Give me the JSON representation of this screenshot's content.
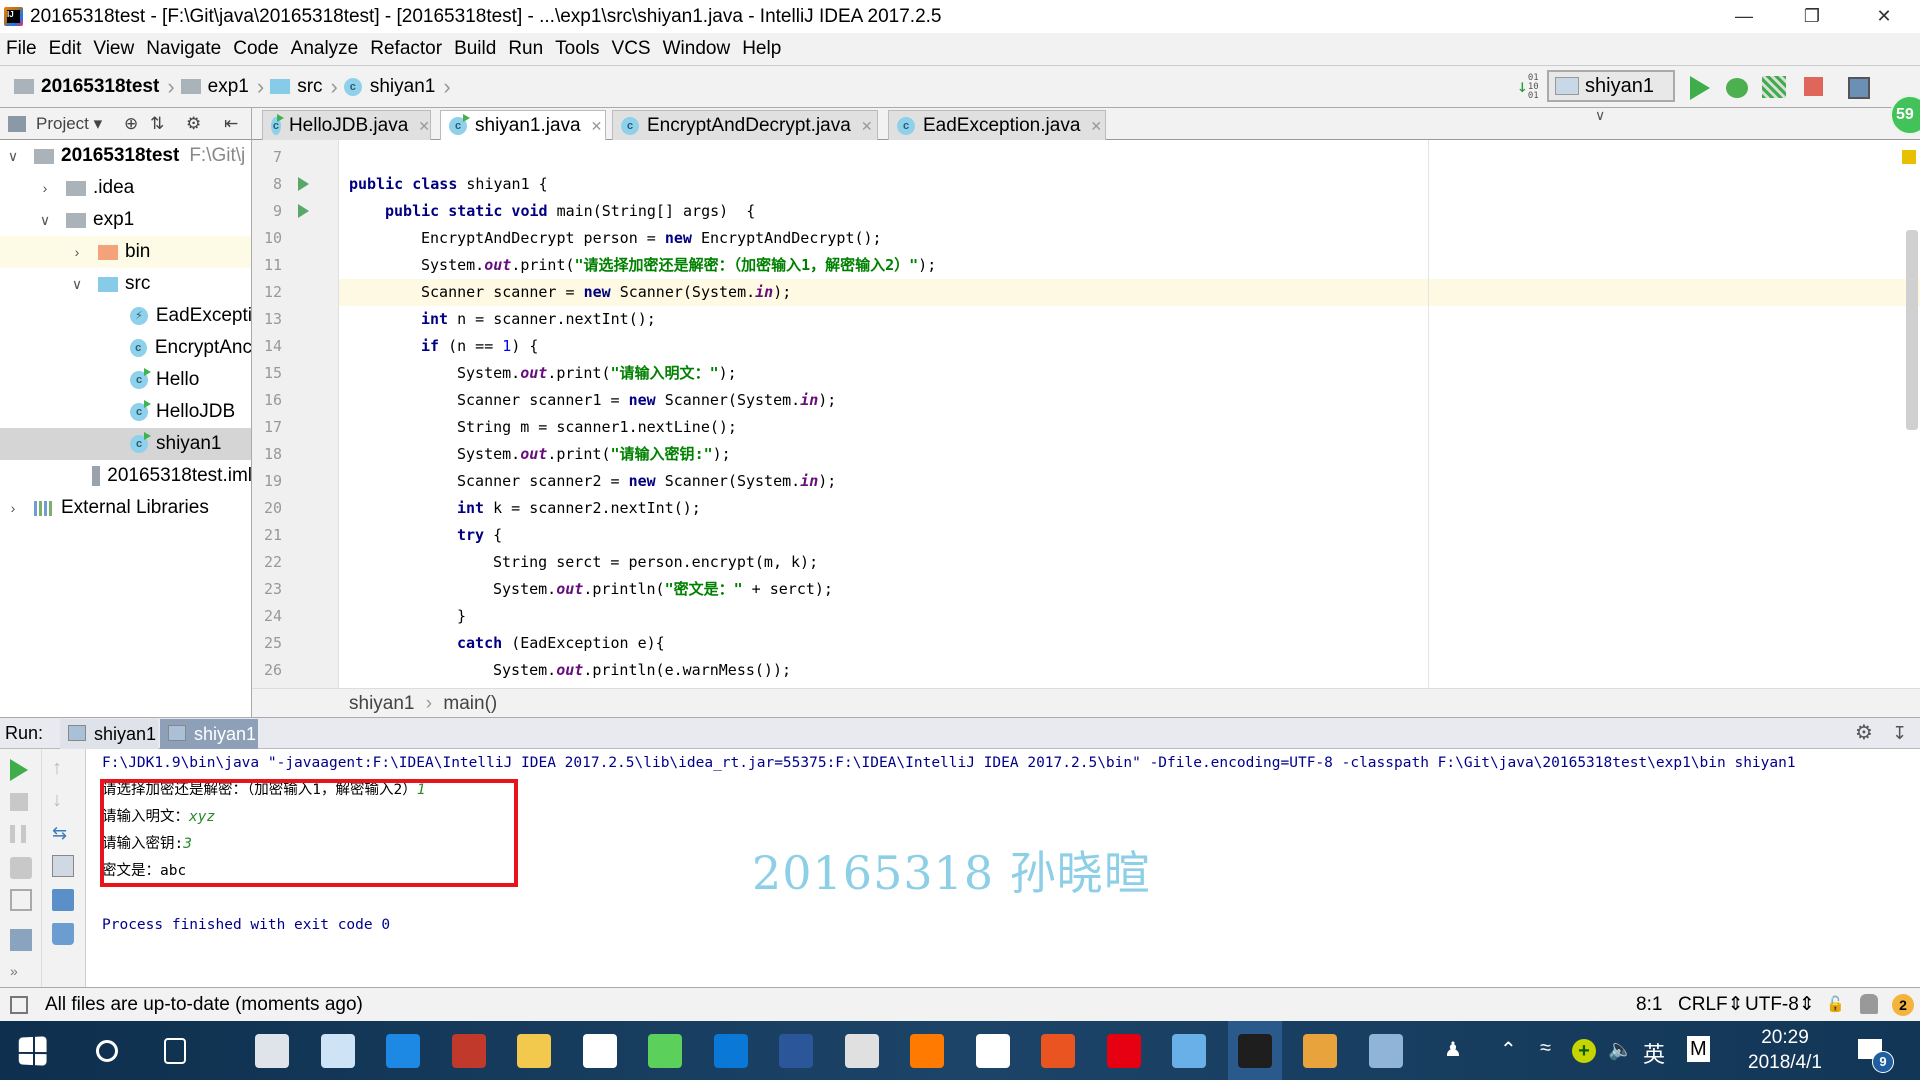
{
  "window": {
    "title": "20165318test - [F:\\Git\\java\\20165318test] - [20165318test] - ...\\exp1\\src\\shiyan1.java - IntelliJ IDEA 2017.2.5",
    "app_icon_text": "IJ"
  },
  "menu": [
    "File",
    "Edit",
    "View",
    "Navigate",
    "Code",
    "Analyze",
    "Refactor",
    "Build",
    "Run",
    "Tools",
    "VCS",
    "Window",
    "Help"
  ],
  "navbar": {
    "crumbs": [
      "20165318test",
      "exp1",
      "src",
      "shiyan1"
    ],
    "run_config": "shiyan1",
    "badge": "59"
  },
  "project": {
    "header": "Project",
    "items": [
      {
        "label": "20165318test",
        "extra": "F:\\Git\\j",
        "depth": 0,
        "arrow": "down",
        "icon": "module"
      },
      {
        "label": ".idea",
        "depth": 1,
        "arrow": "right",
        "icon": "folder"
      },
      {
        "label": "exp1",
        "depth": 1,
        "arrow": "down",
        "icon": "folder"
      },
      {
        "label": "bin",
        "depth": 2,
        "arrow": "right",
        "icon": "folder-orange"
      },
      {
        "label": "src",
        "depth": 2,
        "arrow": "down",
        "icon": "folder-blue"
      },
      {
        "label": "EadExcepti",
        "depth": 3,
        "icon": "exception"
      },
      {
        "label": "EncryptAnc",
        "depth": 3,
        "icon": "class"
      },
      {
        "label": "Hello",
        "depth": 3,
        "icon": "class-run"
      },
      {
        "label": "HelloJDB",
        "depth": 3,
        "icon": "class-run"
      },
      {
        "label": "shiyan1",
        "depth": 3,
        "icon": "class-run",
        "selected": true
      },
      {
        "label": "20165318test.iml",
        "depth": 2,
        "icon": "iml"
      },
      {
        "label": "External Libraries",
        "depth": 0,
        "arrow": "right",
        "icon": "libraries"
      }
    ]
  },
  "tabs": [
    {
      "label": "HelloJDB.java"
    },
    {
      "label": "shiyan1.java",
      "active": true
    },
    {
      "label": "EncryptAndDecrypt.java"
    },
    {
      "label": "EadException.java"
    }
  ],
  "editor": {
    "current_line": 12,
    "lines": [
      {
        "n": "7",
        "indent": 0,
        "tokens": []
      },
      {
        "n": "8",
        "indent": 0,
        "run": true,
        "tokens": [
          [
            "public class ",
            "kw"
          ],
          [
            "shiyan1 {",
            ""
          ]
        ]
      },
      {
        "n": "9",
        "indent": 1,
        "run": true,
        "tokens": [
          [
            "public static void ",
            "kw"
          ],
          [
            "main(String[] args)  {",
            ""
          ]
        ]
      },
      {
        "n": "10",
        "indent": 2,
        "tokens": [
          [
            "EncryptAndDecrypt person = ",
            ""
          ],
          [
            "new ",
            "kw"
          ],
          [
            "EncryptAndDecrypt();",
            ""
          ]
        ]
      },
      {
        "n": "11",
        "indent": 2,
        "tokens": [
          [
            "System.",
            ""
          ],
          [
            "out",
            "fld"
          ],
          [
            ".print(",
            ""
          ],
          [
            "\"请选择加密还是解密：（加密输入1，解密输入2）\"",
            "str"
          ],
          [
            ");",
            ""
          ]
        ]
      },
      {
        "n": "12",
        "indent": 2,
        "tokens": [
          [
            "Scanner scanner = ",
            ""
          ],
          [
            "new ",
            "kw"
          ],
          [
            "Scanner(System.",
            ""
          ],
          [
            "in",
            "fld"
          ],
          [
            ");",
            ""
          ]
        ]
      },
      {
        "n": "13",
        "indent": 2,
        "tokens": [
          [
            "int ",
            "kw"
          ],
          [
            "n = scanner.nextInt();",
            ""
          ]
        ]
      },
      {
        "n": "14",
        "indent": 2,
        "tokens": [
          [
            "if ",
            "kw"
          ],
          [
            "(n == ",
            ""
          ],
          [
            "1",
            "num"
          ],
          [
            ") {",
            ""
          ]
        ]
      },
      {
        "n": "15",
        "indent": 3,
        "tokens": [
          [
            "System.",
            ""
          ],
          [
            "out",
            "fld"
          ],
          [
            ".print(",
            ""
          ],
          [
            "\"请输入明文：\"",
            "str"
          ],
          [
            ");",
            ""
          ]
        ]
      },
      {
        "n": "16",
        "indent": 3,
        "tokens": [
          [
            "Scanner scanner1 = ",
            ""
          ],
          [
            "new ",
            "kw"
          ],
          [
            "Scanner(System.",
            ""
          ],
          [
            "in",
            "fld"
          ],
          [
            ");",
            ""
          ]
        ]
      },
      {
        "n": "17",
        "indent": 3,
        "tokens": [
          [
            "String m = scanner1.nextLine();",
            ""
          ]
        ]
      },
      {
        "n": "18",
        "indent": 3,
        "tokens": [
          [
            "System.",
            ""
          ],
          [
            "out",
            "fld"
          ],
          [
            ".print(",
            ""
          ],
          [
            "\"请输入密钥:\"",
            "str"
          ],
          [
            ");",
            ""
          ]
        ]
      },
      {
        "n": "19",
        "indent": 3,
        "tokens": [
          [
            "Scanner scanner2 = ",
            ""
          ],
          [
            "new ",
            "kw"
          ],
          [
            "Scanner(System.",
            ""
          ],
          [
            "in",
            "fld"
          ],
          [
            ");",
            ""
          ]
        ]
      },
      {
        "n": "20",
        "indent": 3,
        "tokens": [
          [
            "int ",
            "kw"
          ],
          [
            "k = scanner2.nextInt();",
            ""
          ]
        ]
      },
      {
        "n": "21",
        "indent": 3,
        "tokens": [
          [
            "try ",
            "kw"
          ],
          [
            "{",
            ""
          ]
        ]
      },
      {
        "n": "22",
        "indent": 4,
        "tokens": [
          [
            "String serct = person.encrypt(m, k);",
            ""
          ]
        ]
      },
      {
        "n": "23",
        "indent": 4,
        "tokens": [
          [
            "System.",
            ""
          ],
          [
            "out",
            "fld"
          ],
          [
            ".println(",
            ""
          ],
          [
            "\"密文是：\"",
            "str"
          ],
          [
            " + serct);",
            ""
          ]
        ]
      },
      {
        "n": "24",
        "indent": 3,
        "tokens": [
          [
            "}",
            ""
          ]
        ]
      },
      {
        "n": "25",
        "indent": 3,
        "tokens": [
          [
            "catch ",
            "kw"
          ],
          [
            "(EadException e){",
            ""
          ]
        ]
      },
      {
        "n": "26",
        "indent": 4,
        "tokens": [
          [
            "System.",
            ""
          ],
          [
            "out",
            "fld"
          ],
          [
            ".println(e.warnMess());",
            ""
          ]
        ]
      }
    ]
  },
  "breadcrumb": {
    "class": "shiyan1",
    "method": "main()"
  },
  "run": {
    "label": "Run:",
    "tabs": [
      "shiyan1",
      "shiyan1"
    ],
    "command": "F:\\JDK1.9\\bin\\java \"-javaagent:F:\\IDEA\\IntelliJ IDEA 2017.2.5\\lib\\idea_rt.jar=55375:F:\\IDEA\\IntelliJ IDEA 2017.2.5\\bin\" -Dfile.encoding=UTF-8 -classpath F:\\Git\\java\\20165318test\\exp1\\bin shiyan1",
    "output": [
      {
        "text": "请选择加密还是解密：（加密输入1，解密输入2）",
        "input": "1"
      },
      {
        "text": "请输入明文：",
        "input": "xyz"
      },
      {
        "text": "请输入密钥:",
        "input": "3"
      },
      {
        "text": "密文是：abc",
        "input": ""
      }
    ],
    "finished": "Process finished with exit code 0",
    "watermark": "20165318 孙晓暄"
  },
  "status": {
    "message": "All files are up-to-date (moments ago)",
    "position": "8:1",
    "line_sep": "CRLF",
    "encoding": "UTF-8",
    "notifications": "2"
  },
  "taskbar": {
    "ime": "英",
    "ime2": "M",
    "time": "20:29",
    "date": "2018/4/1",
    "action_center_count": "9",
    "apps": [
      "start",
      "cortana",
      "task-view",
      "app-s",
      "feishu",
      "edge",
      "office",
      "file-explorer",
      "baidu-netdisk",
      "wechat",
      "qq",
      "word",
      "snipping",
      "firefox",
      "mail",
      "ubuntu",
      "netease-music",
      "sourcetree",
      "intellij",
      "paint",
      "photos"
    ]
  },
  "colors": {
    "accent_red_box": "#e8141c",
    "keyword": "#000080",
    "string": "#008000",
    "field": "#660e7a",
    "console_sys": "#00008b",
    "watermark": "#8ccfe6"
  }
}
